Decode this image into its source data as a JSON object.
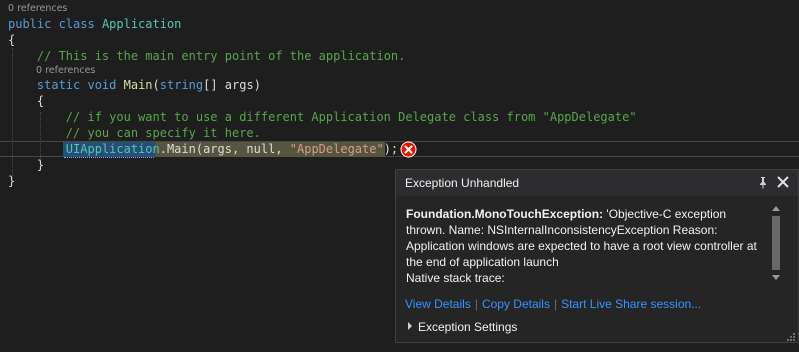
{
  "lens": {
    "class_refs": "0 references",
    "main_refs": "0 references"
  },
  "code": {
    "l1_kw": "public class",
    "l1_type": "Application",
    "l2": "{",
    "l3_comment": "// This is the main entry point of the application.",
    "l4_kw1": "static void",
    "l4_name": "Main",
    "l4_open": "(",
    "l4_kw2": "string",
    "l4_rest": "[] args)",
    "l5": "{",
    "l6_comment": "// if you want to use a different Application Delegate class from \"AppDelegate\"",
    "l7_comment": "// you can specify it here.",
    "l8_type": "UIApplication",
    "l8_mid": ".Main(args, null, ",
    "l8_str": "\"AppDelegate\"",
    "l8_end": ");",
    "l9": "}",
    "l10": "}"
  },
  "popup": {
    "title": "Exception Unhandled",
    "exception_type": "Foundation.MonoTouchException:",
    "message": " 'Objective-C exception thrown.  Name: NSInternalInconsistencyException Reason: Application windows are expected to have a root view controller at the end of application launch",
    "stack_label": "Native stack trace:",
    "links": {
      "view_details": "View Details",
      "copy_details": "Copy Details",
      "live_share": "Start Live Share session..."
    },
    "settings_label": "Exception Settings"
  },
  "colors": {
    "background": "#1e1e1e",
    "keyword": "#569cd6",
    "type": "#4ec9b0",
    "comment": "#57a64a",
    "string": "#d69d85",
    "link": "#3794ff",
    "error": "#e51400"
  },
  "icons": {
    "error_glyph": "error-icon",
    "pin": "pin-icon",
    "close": "close-icon",
    "expand": "expand-caret-icon"
  }
}
